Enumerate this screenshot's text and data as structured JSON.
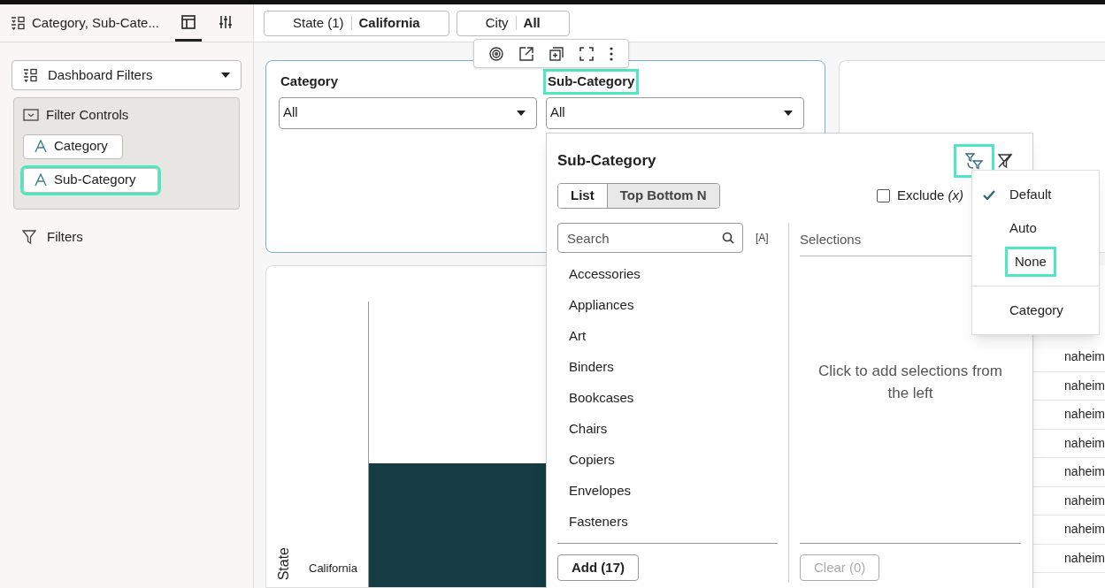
{
  "sidebar": {
    "title": "Category, Sub-Cate...",
    "tabs": [
      {
        "kind": "layout",
        "selected": true
      },
      {
        "kind": "properties",
        "selected": false
      }
    ],
    "dropdown": {
      "label": "Dashboard Filters"
    },
    "filter_controls": {
      "title": "Filter Controls",
      "items": [
        {
          "label": "Category",
          "highlighted": false
        },
        {
          "label": "Sub-Category",
          "highlighted": true
        }
      ]
    },
    "filters_label": "Filters"
  },
  "filter_bar": [
    {
      "name": "State (1)",
      "value": "California"
    },
    {
      "name": "City",
      "value": "All"
    }
  ],
  "filter_card": {
    "controls": [
      {
        "label": "Category",
        "value": "All",
        "highlighted": false
      },
      {
        "label": "Sub-Category",
        "value": "All",
        "highlighted": true
      }
    ]
  },
  "chart": {
    "axis_title": "State",
    "category": "California"
  },
  "table": {
    "column_1": [
      "naheim",
      "naheim",
      "naheim",
      "naheim",
      "naheim",
      "naheim",
      "naheim",
      "naheim"
    ]
  },
  "popup": {
    "title": "Sub-Category",
    "sync_highlighted": true,
    "modes": [
      {
        "label": "List",
        "selected": true
      },
      {
        "label": "Top Bottom N",
        "selected": false
      }
    ],
    "exclude": {
      "label": "Exclude *(x)*",
      "checked": false
    },
    "search": {
      "placeholder": "Search"
    },
    "case_toggle": "[A]",
    "items": [
      "Accessories",
      "Appliances",
      "Art",
      "Binders",
      "Bookcases",
      "Chairs",
      "Copiers",
      "Envelopes",
      "Fasteners"
    ],
    "selections_title": "Selections",
    "empty_message": "Click to add selections from the left",
    "add_button": {
      "label": "Add (17)",
      "disabled": false
    },
    "clear_button": {
      "label": "Clear (0)",
      "disabled": true
    }
  },
  "menu": [
    {
      "kind": "option",
      "label": "Default",
      "checked": true,
      "highlighted": false
    },
    {
      "kind": "option",
      "label": "Auto",
      "checked": false,
      "highlighted": false
    },
    {
      "kind": "option",
      "label": "None",
      "checked": false,
      "highlighted": true
    },
    {
      "kind": "option",
      "label": "Category",
      "checked": false,
      "highlighted": false
    }
  ]
}
